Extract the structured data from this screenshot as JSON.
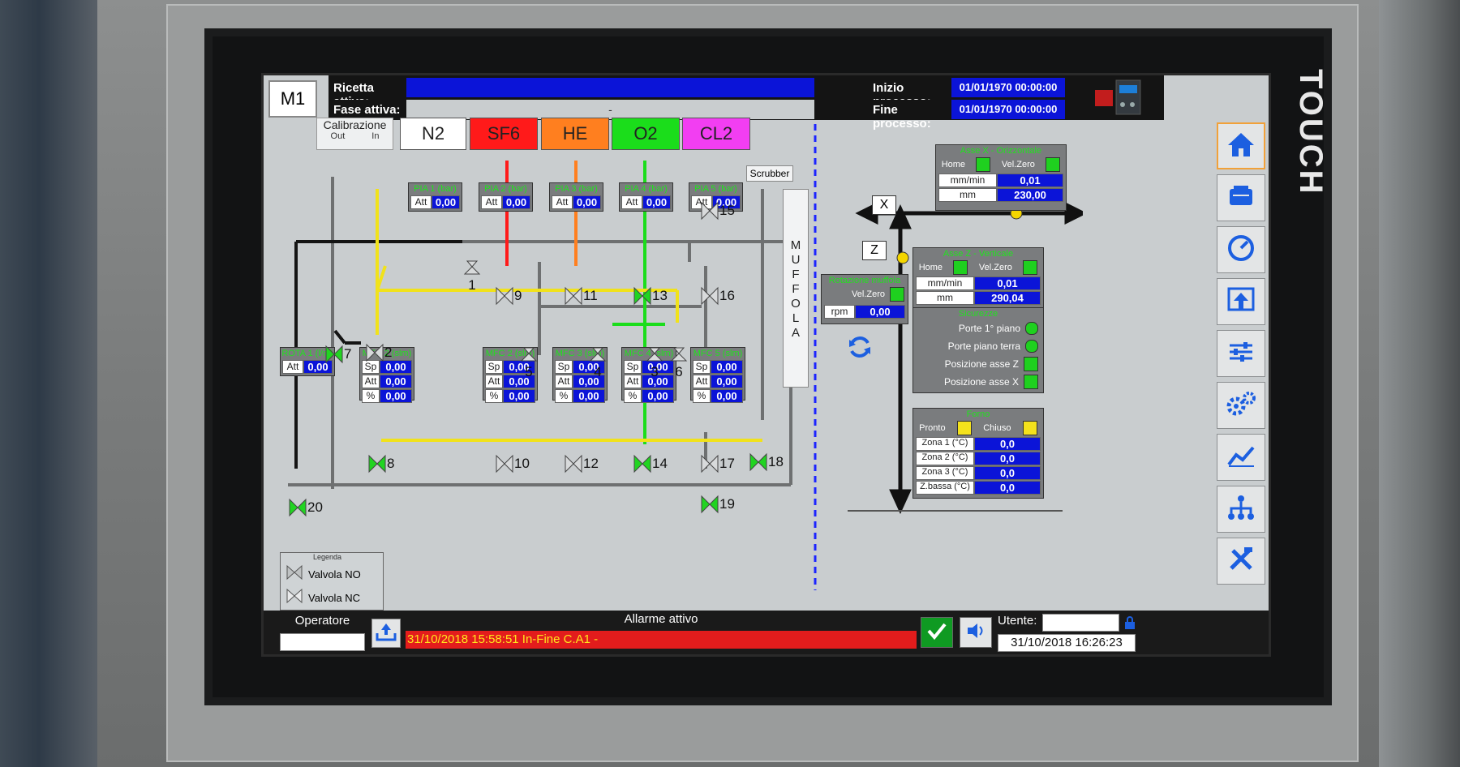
{
  "brand": "TOUCH",
  "header": {
    "machine_id": "M1",
    "recipe_label": "Ricetta attiva:",
    "recipe_value": "",
    "phase_label": "Fase attiva:",
    "phase_value": "-",
    "start_label": "Inizio processo:",
    "start_value": "01/01/1970 00:00:00",
    "end_label": "Fine processo:",
    "end_value": "01/01/1970 00:00:00"
  },
  "calibration": {
    "title": "Calibrazione",
    "out": "Out",
    "in": "In"
  },
  "gases": [
    {
      "label": "N2",
      "color": "#ffffff"
    },
    {
      "label": "SF6",
      "color": "#ff1a1a"
    },
    {
      "label": "HE",
      "color": "#ff7f1f"
    },
    {
      "label": "O2",
      "color": "#1bdd1b"
    },
    {
      "label": "CL2",
      "color": "#f23ef2"
    }
  ],
  "pia": [
    {
      "title": "PIA 1 (bar)",
      "att_label": "Att",
      "att": "0,00"
    },
    {
      "title": "PIA 2 (bar)",
      "att_label": "Att",
      "att": "0,00"
    },
    {
      "title": "PIA 3 (bar)",
      "att_label": "Att",
      "att": "0,00"
    },
    {
      "title": "PIA 4 (bar)",
      "att_label": "Att",
      "att": "0,00"
    },
    {
      "title": "PIA 5 (bar)",
      "att_label": "Att",
      "att": "0,00"
    }
  ],
  "rota": {
    "title": "ROTA 1 (l/m)",
    "att_label": "Att",
    "att": "0,00"
  },
  "mfc": [
    {
      "title": "MFC 2 (slm)",
      "sp": "0,00",
      "att": "0,00",
      "pct": "0,00"
    },
    {
      "title": "MFC 2 (slm)",
      "sp": "0,00",
      "att": "0,00",
      "pct": "0,00"
    },
    {
      "title": "MFC 3 (slm)",
      "sp": "0,00",
      "att": "0,00",
      "pct": "0,00"
    },
    {
      "title": "MFC 4 (slm)",
      "sp": "0,00",
      "att": "0,00",
      "pct": "0,00"
    },
    {
      "title": "MFC 5 (slm)",
      "sp": "0,00",
      "att": "0,00",
      "pct": "0,00"
    }
  ],
  "mfc_labels": {
    "sp": "Sp",
    "att": "Att",
    "pct": "%"
  },
  "valves": [
    "1",
    "2",
    "3",
    "4",
    "5",
    "6",
    "7",
    "8",
    "9",
    "10",
    "11",
    "12",
    "13",
    "14",
    "15",
    "16",
    "17",
    "18",
    "19",
    "20"
  ],
  "scrubber": "Scrubber",
  "muffola": [
    "M",
    "U",
    "F",
    "F",
    "O",
    "L",
    "A"
  ],
  "legend": {
    "title": "Legenda",
    "no": "Valvola NO",
    "nc": "Valvola NC"
  },
  "axis_x": {
    "title": "Asse X - Orizzontale",
    "home": "Home",
    "velzero": "Vel.Zero",
    "row1_label": "mm/min",
    "row1_value": "0,01",
    "row2_label": "mm",
    "row2_value": "230,00",
    "tag": "X"
  },
  "axis_z": {
    "title": "Asse Z - Verticale",
    "home": "Home",
    "velzero": "Vel.Zero",
    "row1_label": "mm/min",
    "row1_value": "0,01",
    "row2_label": "mm",
    "row2_value": "290,04",
    "tag": "Z"
  },
  "rotation": {
    "title": "Rotazione muffola",
    "velzero": "Vel.Zero",
    "rpm_label": "rpm",
    "rpm_value": "0,00"
  },
  "safety": {
    "title": "Sicurezze",
    "items": [
      "Porte 1° piano",
      "Porte piano terra",
      "Posizione asse Z",
      "Posizione asse X"
    ]
  },
  "furnace": {
    "title": "Forno",
    "ready": "Pronto",
    "closed": "Chiuso",
    "zones": [
      {
        "label": "Zona 1 (°C)",
        "value": "0,0"
      },
      {
        "label": "Zona 2 (°C)",
        "value": "0,0"
      },
      {
        "label": "Zona 3 (°C)",
        "value": "0,0"
      },
      {
        "label": "Z.bassa (°C)",
        "value": "0,0"
      }
    ]
  },
  "footer": {
    "operator_label": "Operatore",
    "operator_value": "",
    "alarm_title": "Allarme attivo",
    "alarm_text": "31/10/2018  15:58:51  In-Fine  C.A1 -",
    "user_label": "Utente:",
    "user_value": "",
    "datetime": "31/10/2018 16:26:23"
  },
  "nav_icons": [
    "home-icon",
    "cylinder-icon",
    "gauge-icon",
    "upload-icon",
    "sliders-icon",
    "gears-icon",
    "trend-icon",
    "hierarchy-icon",
    "tools-icon"
  ]
}
